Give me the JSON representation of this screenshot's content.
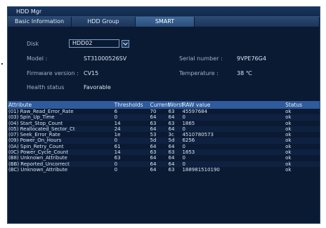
{
  "window": {
    "title": "HDD Mgr"
  },
  "tabs": [
    {
      "label": "Basic Information"
    },
    {
      "label": "HDD Group"
    },
    {
      "label": "SMART"
    }
  ],
  "disk": {
    "label": "Disk",
    "value": "HDD02"
  },
  "info": {
    "model_label": "Model :",
    "model_value": "ST31000526SV",
    "serial_label": "Serial number :",
    "serial_value": "9VPE76G4",
    "firmware_label": "Firmware version :",
    "firmware_value": "CV15",
    "temperature_label": "Temperature :",
    "temperature_value": "38 ℃",
    "health_label": "Health status",
    "health_value": "Favorable"
  },
  "table": {
    "headers": [
      "Attribute",
      "Thresholds",
      "Current",
      "Worst",
      "RAW value",
      "Status"
    ],
    "rows": [
      [
        "(01) Raw_Read_Error_Rate",
        "6",
        "70",
        "63",
        "45597684",
        "ok"
      ],
      [
        "(03) Spin_Up_Time",
        "0",
        "64",
        "64",
        "0",
        "ok"
      ],
      [
        "(04) Start_Stop_Count",
        "14",
        "63",
        "63",
        "1865",
        "ok"
      ],
      [
        "(05) Reallocated_Sector_Ct",
        "24",
        "64",
        "64",
        "0",
        "ok"
      ],
      [
        "(07) Seek_Error_Rate",
        "1e",
        "53",
        "3c",
        "4510780573",
        "ok"
      ],
      [
        "(09) Power_On_Hours",
        "0",
        "5d",
        "5d",
        "6256",
        "ok"
      ],
      [
        "(0A) Spin_Retry_Count",
        "61",
        "64",
        "64",
        "0",
        "ok"
      ],
      [
        "(0C) Power_Cycle_Count",
        "14",
        "63",
        "63",
        "1853",
        "ok"
      ],
      [
        "(B8) Unknown_Attribute",
        "63",
        "64",
        "64",
        "0",
        "ok"
      ],
      [
        "(BB) Reported_Uncorrect",
        "0",
        "64",
        "64",
        "0",
        "ok"
      ],
      [
        "(BC) Unknown_Attribute",
        "0",
        "64",
        "63",
        "188981510190",
        "ok"
      ]
    ]
  }
}
